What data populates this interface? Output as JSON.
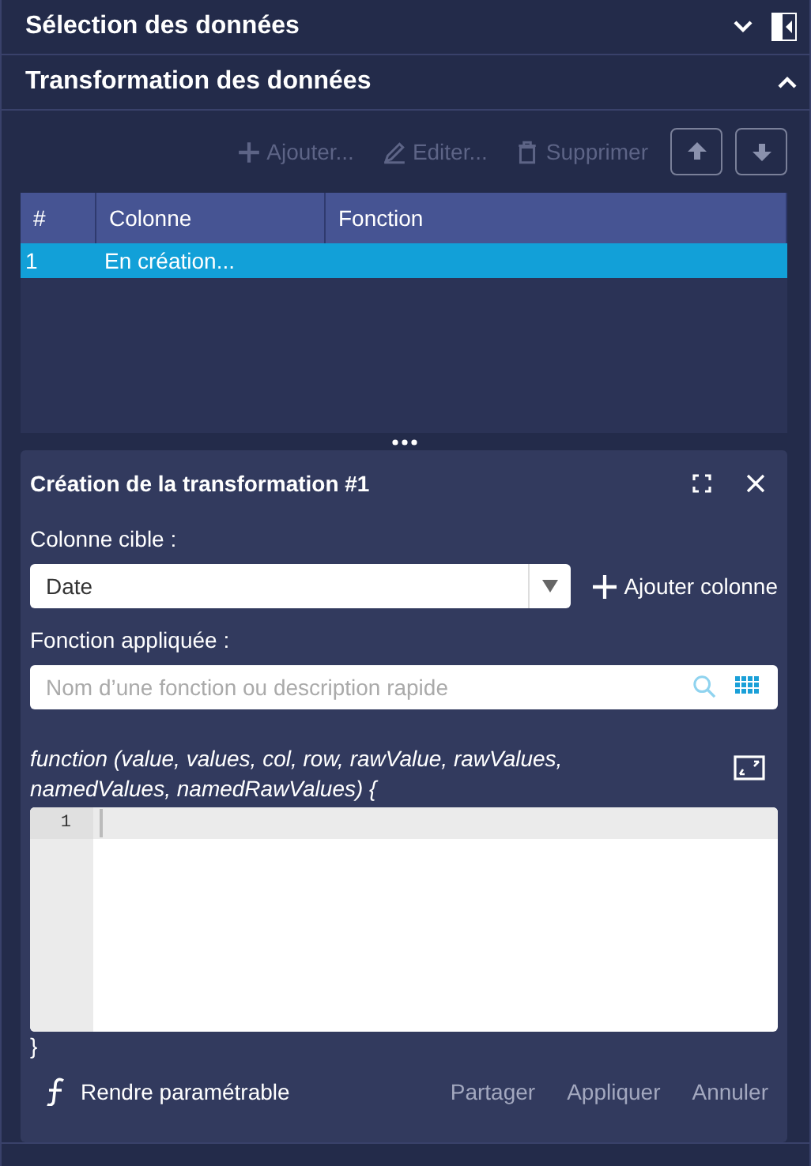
{
  "sections": [
    {
      "title": "Sélection des données",
      "expanded": false
    },
    {
      "title": "Transformation des données",
      "expanded": true
    }
  ],
  "toolbar": [
    {
      "label": "Ajouter...",
      "kind": "add",
      "disabled": true
    },
    {
      "label": "Editer...",
      "kind": "edit",
      "disabled": true
    },
    {
      "label": "Supprimer",
      "kind": "delete",
      "disabled": true
    }
  ],
  "table": {
    "columns": [
      "#",
      "Colonne",
      "Fonction"
    ],
    "rows": [
      {
        "cells": [
          "1",
          "En création...",
          ""
        ],
        "selected": true
      }
    ]
  },
  "panel": {
    "title": "Création de la transformation #1",
    "target_label": "Colonne cible :",
    "target_value": "Date",
    "add_column": "Ajouter colonne",
    "function_label": "Fonction appliquée :",
    "function_placeholder": "Nom d’une fonction ou description rapide",
    "signature": "function (value, values, col, row, rawValue, rawValues, namedValues, namedRawValues) {",
    "line_numbers": [
      "1"
    ],
    "closing": "}",
    "parametrize": "Rendre paramétrable",
    "actions": [
      {
        "label": "Partager",
        "disabled": true
      },
      {
        "label": "Appliquer",
        "disabled": true
      },
      {
        "label": "Annuler",
        "disabled": true
      }
    ]
  }
}
